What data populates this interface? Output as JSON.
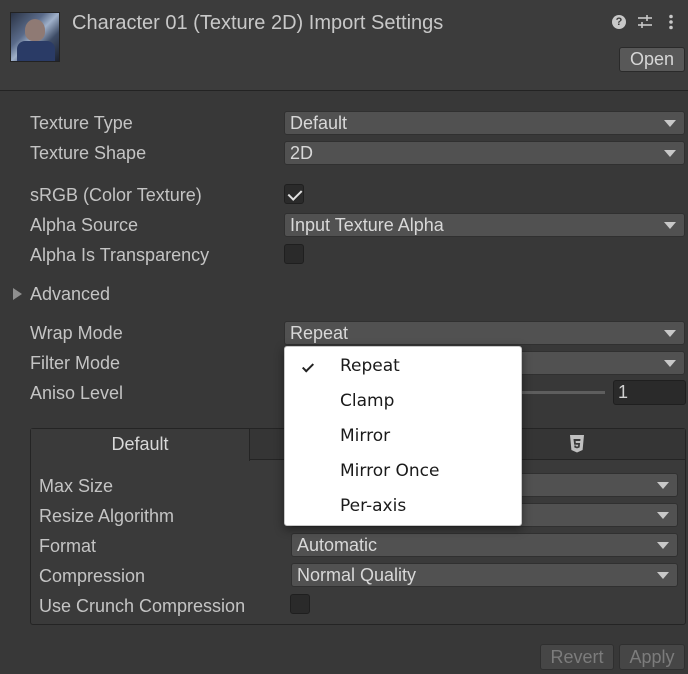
{
  "header": {
    "title": "Character 01 (Texture 2D) Import Settings",
    "open_label": "Open",
    "icons": [
      "help-icon",
      "preset-icon",
      "more-icon"
    ]
  },
  "fields": {
    "texture_type": {
      "label": "Texture Type",
      "value": "Default"
    },
    "texture_shape": {
      "label": "Texture Shape",
      "value": "2D"
    },
    "srgb": {
      "label": "sRGB (Color Texture)",
      "checked": true
    },
    "alpha_source": {
      "label": "Alpha Source",
      "value": "Input Texture Alpha"
    },
    "alpha_is_transparency": {
      "label": "Alpha Is Transparency",
      "checked": false
    },
    "advanced": {
      "label": "Advanced"
    },
    "wrap_mode": {
      "label": "Wrap Mode",
      "value": "Repeat"
    },
    "filter_mode": {
      "label": "Filter Mode"
    },
    "aniso_level": {
      "label": "Aniso Level",
      "value": "1"
    }
  },
  "platform": {
    "tabs": [
      {
        "label": "Default",
        "icon": null
      },
      {
        "label": "",
        "icon": "html5-icon"
      }
    ],
    "max_size": {
      "label": "Max Size"
    },
    "resize_algorithm": {
      "label": "Resize Algorithm"
    },
    "format": {
      "label": "Format",
      "value": "Automatic"
    },
    "compression": {
      "label": "Compression",
      "value": "Normal Quality"
    },
    "use_crunch": {
      "label": "Use Crunch Compression",
      "checked": false
    }
  },
  "footer": {
    "revert_label": "Revert",
    "apply_label": "Apply"
  },
  "wrap_mode_menu": {
    "selected": "Repeat",
    "options": [
      "Repeat",
      "Clamp",
      "Mirror",
      "Mirror Once",
      "Per-axis"
    ]
  }
}
